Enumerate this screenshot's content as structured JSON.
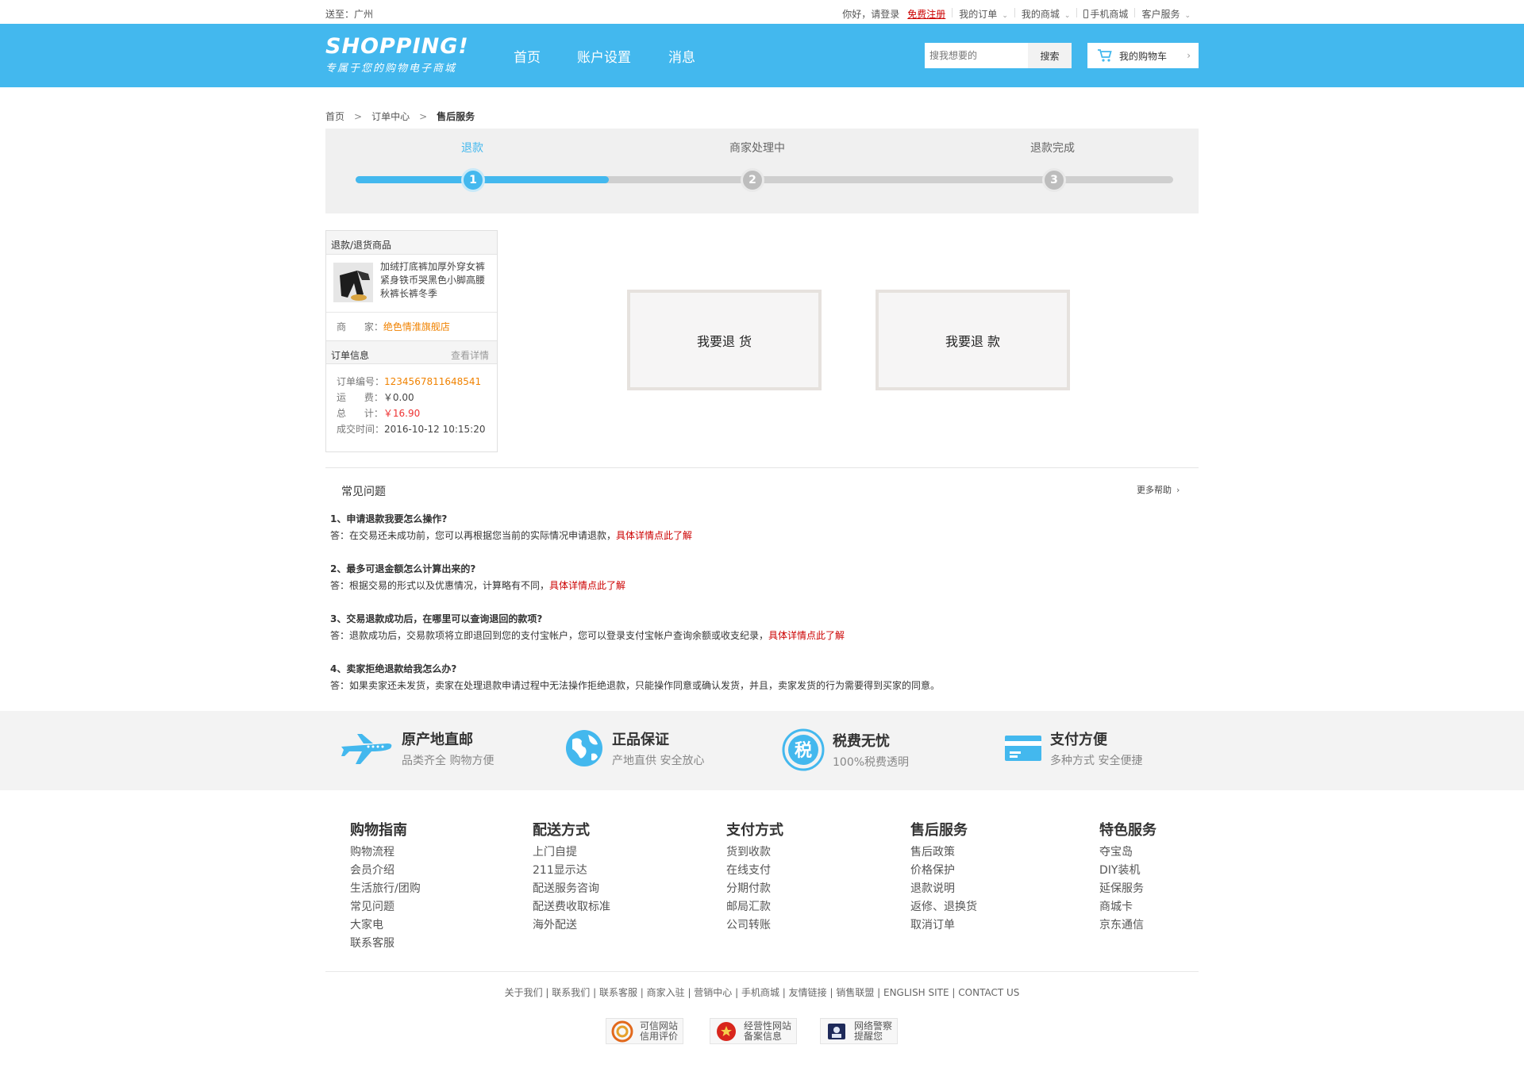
{
  "topbar": {
    "ship_to": "送至：广州",
    "greeting": "你好，请登录",
    "register": "免费注册",
    "my_orders": "我的订单",
    "my_mall": "我的商城",
    "mobile": "手机商城",
    "service": "客户服务"
  },
  "header": {
    "logo": "SHOPPING!",
    "slogan": "专属于您的购物电子商城",
    "nav": [
      "首页",
      "账户设置",
      "消息"
    ],
    "search_placeholder": "搜我想要的",
    "search_btn": "搜索",
    "cart": "我的购物车"
  },
  "breadcrumb": [
    "首页",
    "订单中心",
    "售后服务"
  ],
  "progress": {
    "steps": [
      {
        "label": "退款",
        "num": "1"
      },
      {
        "label": "商家处理中",
        "num": "2"
      },
      {
        "label": "退款完成",
        "num": "3"
      }
    ],
    "active_step": 1,
    "fill_fraction": 0.31
  },
  "side": {
    "goods_header": "退款/退货商品",
    "product_name": "加绒打底裤加厚外穿女裤紧身铁币哭黑色小脚高腰秋裤长裤冬季",
    "merchant_label": "商      家：",
    "merchant": "绝色情淮旗舰店",
    "order_header": "订单信息",
    "view_detail": "查看详情",
    "order_no_label": "订单编号：",
    "order_no": "1234567811648541",
    "freight_label": "运      费：",
    "freight": "￥0.00",
    "total_label": "总      计：",
    "total": "￥16.90",
    "time_label": "成交时间：",
    "time": "2016-10-12 10:15:20"
  },
  "actions": {
    "return_goods": "我要退 货",
    "refund": "我要退 款"
  },
  "faq": {
    "title": "常见问题",
    "more": "更多帮助",
    "items": [
      {
        "q": "1、申请退款我要怎么操作?",
        "a": "答：在交易还未成功前，您可以再根据您当前的实际情况申请退款，",
        "link": "具体详情点此了解"
      },
      {
        "q": "2、最多可退金额怎么计算出来的?",
        "a": "答：根据交易的形式以及优惠情况，计算略有不同，",
        "link": "具体详情点此了解"
      },
      {
        "q": "3、交易退款成功后，在哪里可以查询退回的款项?",
        "a": "答：退款成功后，交易款项将立即退回到您的支付宝帐户，您可以登录支付宝帐户查询余额或收支纪录，",
        "link": "具体详情点此了解"
      },
      {
        "q": "4、卖家拒绝退款给我怎么办?",
        "a": "答：如果卖家还未发货，卖家在处理退款申请过程中无法操作拒绝退款，只能操作同意或确认发货，并且，卖家发货的行为需要得到买家的同意。",
        "link": ""
      }
    ]
  },
  "features": [
    {
      "title": "原产地直邮",
      "sub": "品类齐全 购物方便",
      "icon": "airplane-icon"
    },
    {
      "title": "正品保证",
      "sub": "产地直供 安全放心",
      "icon": "globe-icon"
    },
    {
      "title": "税费无忧",
      "sub": "100%税费透明",
      "icon": "tax-icon",
      "glyph": "税"
    },
    {
      "title": "支付方便",
      "sub": "多种方式 安全便捷",
      "icon": "card-icon"
    }
  ],
  "footer_cols": [
    {
      "title": "购物指南",
      "items": [
        "购物流程",
        "会员介绍",
        "生活旅行/团购",
        "常见问题",
        "大家电",
        "联系客服"
      ]
    },
    {
      "title": "配送方式",
      "items": [
        "上门自提",
        "211显示达",
        "配送服务咨询",
        "配送费收取标准",
        "海外配送"
      ]
    },
    {
      "title": "支付方式",
      "items": [
        "货到收款",
        "在线支付",
        "分期付款",
        "邮局汇款",
        "公司转账"
      ]
    },
    {
      "title": "售后服务",
      "items": [
        "售后政策",
        "价格保护",
        "退款说明",
        "返修、退换货",
        "取消订单"
      ]
    },
    {
      "title": "特色服务",
      "items": [
        "夺宝岛",
        "DIY装机",
        "延保服务",
        "商城卡",
        "京东通信"
      ]
    }
  ],
  "footer_links": "关于我们 | 联系我们 | 联系客服 | 商家入驻 | 营销中心 | 手机商城 | 友情链接 | 销售联盟 | ENGLISH SITE | CONTACT US",
  "badges": [
    {
      "l1": "可信网站",
      "l2": "信用评价"
    },
    {
      "l1": "经营性网站",
      "l2": "备案信息"
    },
    {
      "l1": "网络警察",
      "l2": "提醒您"
    }
  ],
  "colors": {
    "brand": "#43b8ee",
    "link_red": "#cc0000",
    "orange": "#f08200"
  }
}
